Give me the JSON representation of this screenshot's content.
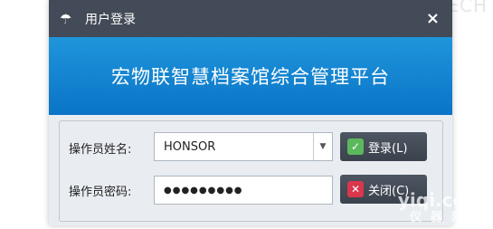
{
  "background_text": "SHORTTECH",
  "window": {
    "title": "用户登录",
    "close_symbol": "×"
  },
  "banner": {
    "text": "宏物联智慧档案馆综合管理平台"
  },
  "form": {
    "username_label": "操作员姓名:",
    "username_value": "HONSOR",
    "password_label": "操作员密码:",
    "password_value": "●●●●●●●●●"
  },
  "buttons": {
    "login_label": "登录(L)",
    "close_label": "关闭(C)"
  },
  "watermark": {
    "line1": "yiqi.com",
    "line2": "仪器网"
  },
  "colors": {
    "titlebar": "#424b57",
    "banner": "#1a8ad6",
    "login_icon": "#5cb85c",
    "close_icon": "#d9374b"
  }
}
